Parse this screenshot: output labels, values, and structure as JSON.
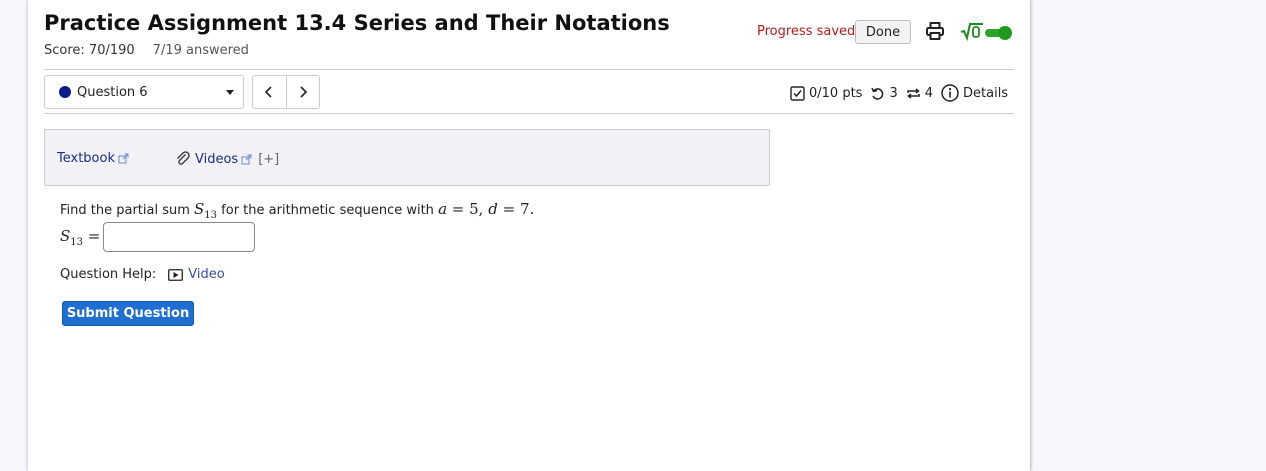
{
  "assignment": {
    "title": "Practice Assignment 13.4 Series and Their Notations",
    "score": "Score: 70/190",
    "answered": "7/19 answered"
  },
  "header": {
    "progress_text": "Progress saved",
    "done_label": "Done",
    "math_toggle_label": "√0"
  },
  "question_nav": {
    "selected": "Question 6",
    "prev_icon": "‹",
    "next_icon": "›"
  },
  "metrics": {
    "points": "0/10 pts",
    "retries": "3",
    "attempts": "4",
    "details": "Details"
  },
  "resources": {
    "textbook": "Textbook",
    "videos": "Videos",
    "expand": "[+]"
  },
  "question": {
    "prefix": "Find the partial sum ",
    "mid": " for the arithmetic sequence with ",
    "sum_var": "S",
    "sum_sub": "13",
    "a_var": "a",
    "eq": " = ",
    "a_val": "5",
    "comma": ", ",
    "d_var": "d",
    "d_val": "7",
    "period": "."
  },
  "answer": {
    "label_var": "S",
    "label_sub": "13",
    "label_eq": " =",
    "value": ""
  },
  "help": {
    "label": "Question Help:",
    "video": "Video"
  },
  "submit": {
    "label": "Submit Question"
  },
  "colors": {
    "progress": "#b01c1c",
    "submit": "#1e6fd1",
    "toggle": "#2aa12a",
    "link": "#1b2d88"
  }
}
